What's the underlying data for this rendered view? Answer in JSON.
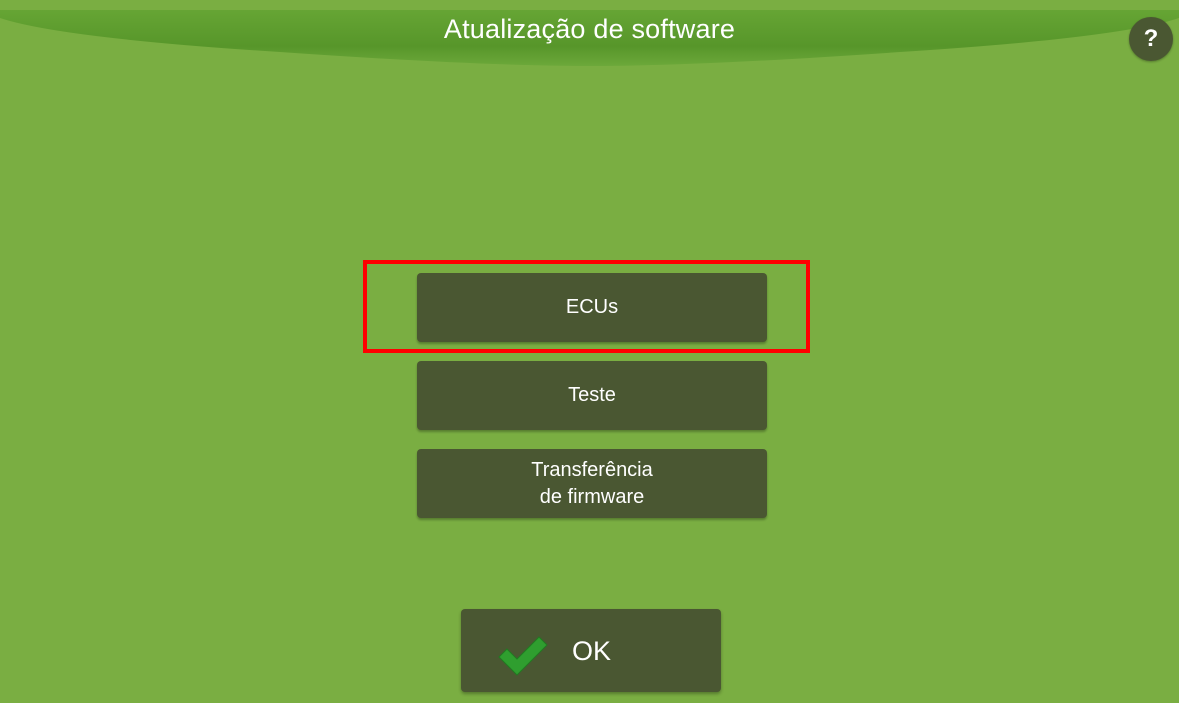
{
  "header": {
    "title": "Atualização de software",
    "help_label": "?"
  },
  "menu": {
    "ecus_label": "ECUs",
    "teste_label": "Teste",
    "transfer_line1": "Transferência",
    "transfer_line2": "de firmware"
  },
  "footer": {
    "ok_label": "OK"
  },
  "icons": {
    "help": "question-mark-icon",
    "ok": "checkmark-icon"
  },
  "colors": {
    "background": "#7aae42",
    "header": "#59992a",
    "button": "#4a5732",
    "text": "#ffffff",
    "highlight": "#ff0000",
    "check": "#2f9e2f"
  }
}
